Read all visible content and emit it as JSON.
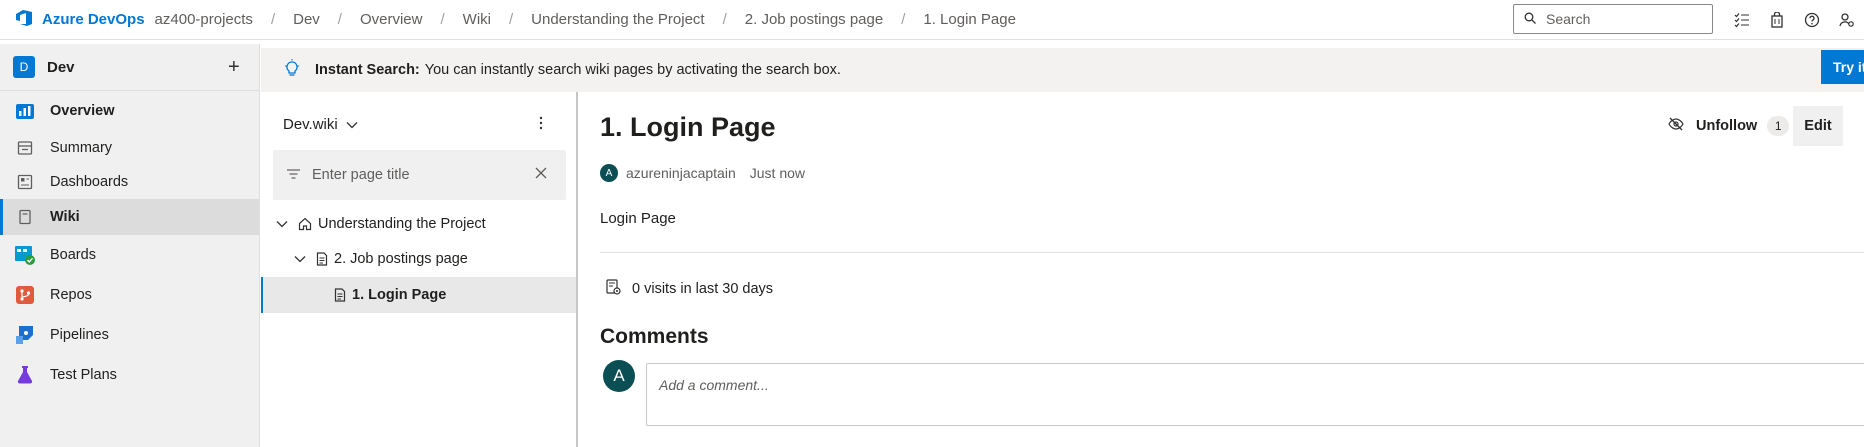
{
  "topbar": {
    "brand": "Azure DevOps",
    "breadcrumbs": [
      "az400-projects",
      "Dev",
      "Overview",
      "Wiki",
      "Understanding the Project",
      "2. Job postings page",
      "1. Login Page"
    ],
    "search_placeholder": "Search",
    "icons": [
      "task-list-icon",
      "shopping-bag-icon",
      "help-icon",
      "user-settings-icon"
    ]
  },
  "sidebar": {
    "project_initial": "D",
    "project_name": "Dev",
    "add_icon": "+",
    "items": [
      {
        "label": "Overview",
        "icon": "overview-icon",
        "color": "#0078d4",
        "bold": true
      },
      {
        "label": "Summary",
        "icon": "summary-icon",
        "color": "#605e5c"
      },
      {
        "label": "Dashboards",
        "icon": "dashboards-icon",
        "color": "#605e5c"
      },
      {
        "label": "Wiki",
        "icon": "wiki-icon",
        "color": "#605e5c",
        "selected": true,
        "bold": true
      },
      {
        "label": "Boards",
        "icon": "boards-icon",
        "color": "#009ccc"
      },
      {
        "label": "Repos",
        "icon": "repos-icon",
        "color": "#e05b3d"
      },
      {
        "label": "Pipelines",
        "icon": "pipelines-icon",
        "color": "#1c6fd1"
      },
      {
        "label": "Test Plans",
        "icon": "test-plans-icon",
        "color": "#773adc"
      }
    ]
  },
  "banner": {
    "title": "Instant Search:",
    "text": "You can instantly search wiki pages by activating the search box.",
    "button": "Try it"
  },
  "wiki_tree": {
    "wiki_name": "Dev.wiki",
    "filter_placeholder": "Enter page title",
    "pages": [
      {
        "label": "Understanding the Project",
        "level": 0,
        "expanded": true,
        "icon": "home-icon"
      },
      {
        "label": "2. Job postings page",
        "level": 1,
        "expanded": true,
        "icon": "page-icon"
      },
      {
        "label": "1. Login Page",
        "level": 2,
        "selected": true,
        "icon": "page-icon"
      }
    ]
  },
  "page": {
    "title": "1. Login Page",
    "unfollow_label": "Unfollow",
    "follow_count": "1",
    "edit_label": "Edit",
    "author_initial": "A",
    "author": "azureninjacaptain",
    "time": "Just now",
    "body": "Login Page",
    "visits": "0 visits in last 30 days",
    "comments_title": "Comments",
    "comment_avatar": "A",
    "comment_placeholder": "Add a comment..."
  },
  "colors": {
    "accent": "#0078d4",
    "avatar": "#0b4f55"
  }
}
